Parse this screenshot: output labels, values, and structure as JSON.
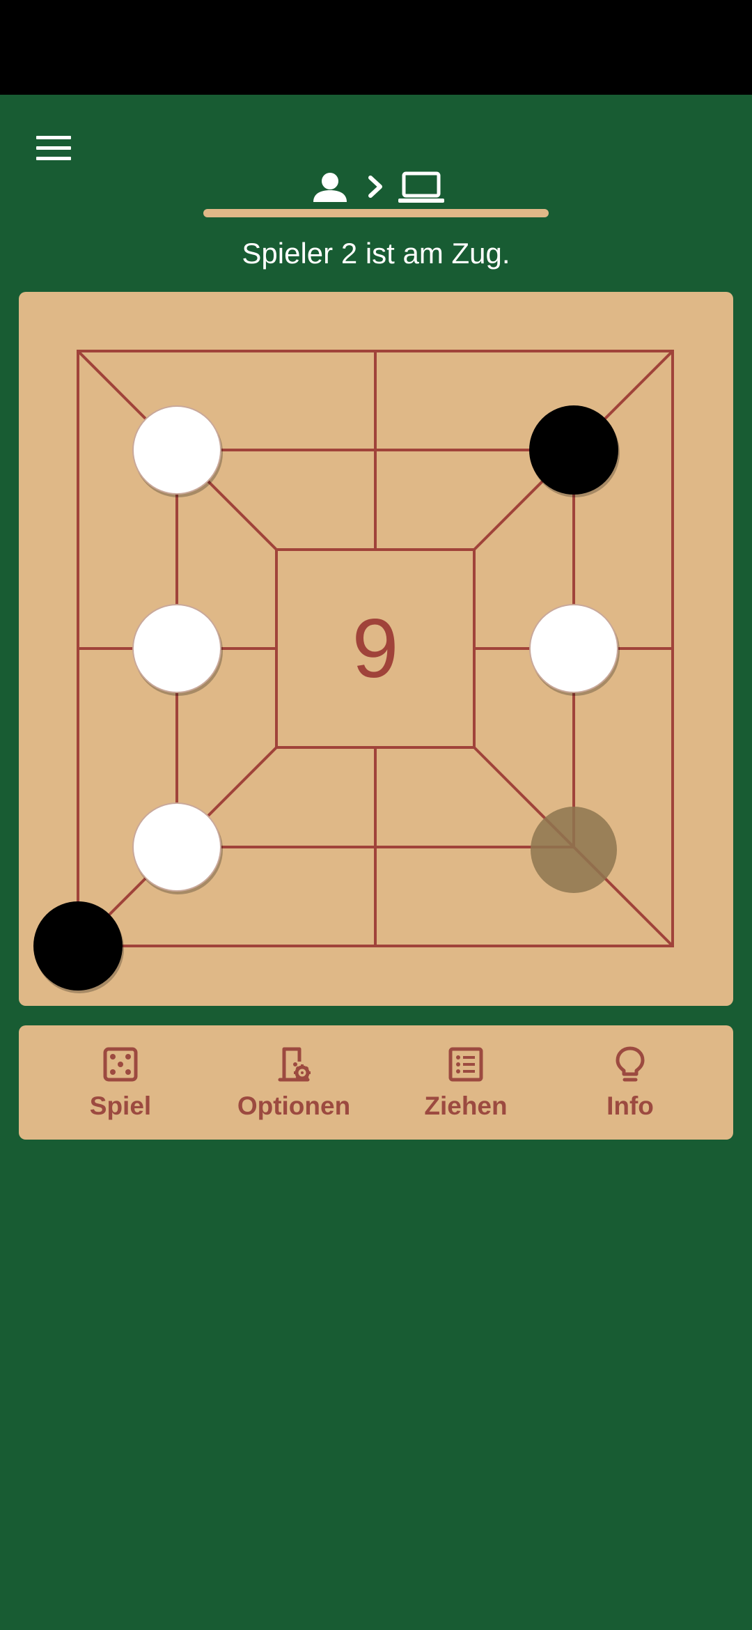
{
  "header": {
    "menu_icon": "hamburger-menu-icon",
    "mode_icons": [
      "person-icon",
      "chevron-right-icon",
      "laptop-icon"
    ],
    "turn_text": "Spieler 2 ist am Zug."
  },
  "board": {
    "center_count": "9",
    "colors": {
      "board": "#DFB887",
      "lines": "#A0433A",
      "white_piece": "#FFFFFF",
      "black_piece": "#000000",
      "highlight": "#8E7650"
    },
    "pieces": [
      {
        "ring": "middle",
        "position": "top-left",
        "color": "white"
      },
      {
        "ring": "middle",
        "position": "top-right",
        "color": "black"
      },
      {
        "ring": "middle",
        "position": "left",
        "color": "white"
      },
      {
        "ring": "middle",
        "position": "right",
        "color": "white"
      },
      {
        "ring": "middle",
        "position": "bottom-left",
        "color": "white"
      },
      {
        "ring": "outer",
        "position": "bottom-left",
        "color": "black"
      }
    ],
    "highlighted_point": {
      "ring": "middle",
      "position": "bottom-right"
    }
  },
  "nav": {
    "items": [
      {
        "label": "Spiel",
        "icon": "dice-icon"
      },
      {
        "label": "Optionen",
        "icon": "door-settings-icon"
      },
      {
        "label": "Ziehen",
        "icon": "list-icon"
      },
      {
        "label": "Info",
        "icon": "lightbulb-icon"
      }
    ]
  }
}
